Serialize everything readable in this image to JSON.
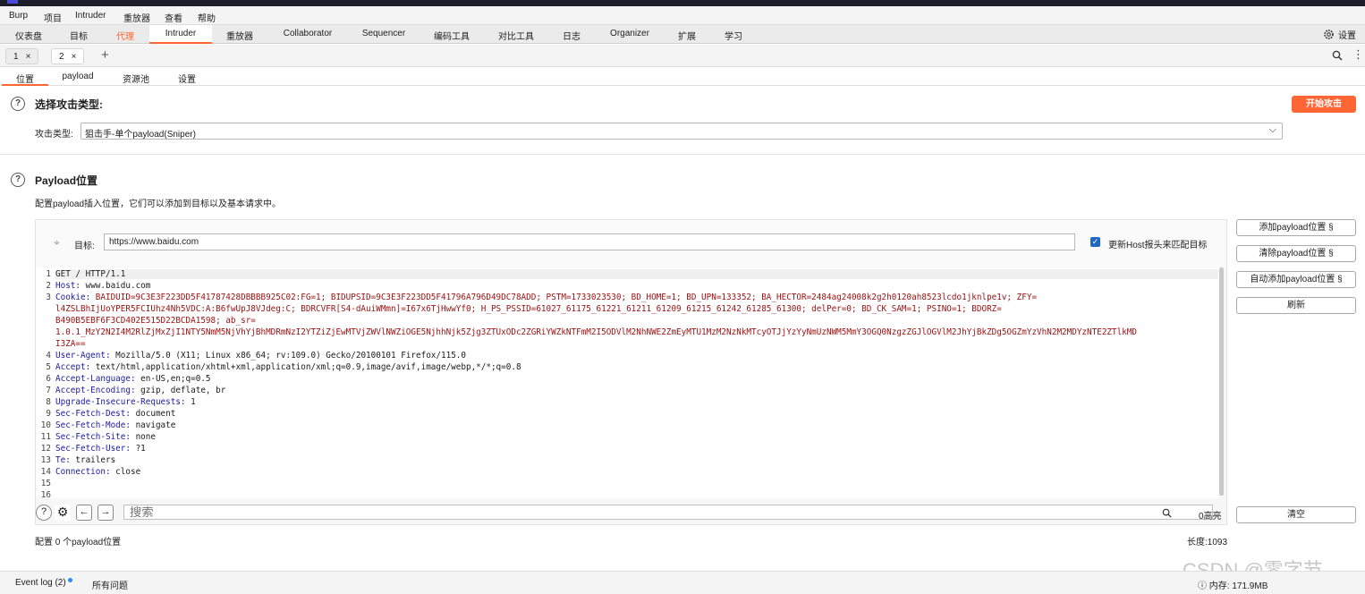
{
  "menu": [
    "Burp",
    "项目",
    "Intruder",
    "重放器",
    "查看",
    "帮助"
  ],
  "main_tabs": [
    "仪表盘",
    "目标",
    "代理",
    "Intruder",
    "重放器",
    "Collaborator",
    "Sequencer",
    "编码工具",
    "对比工具",
    "日志",
    "Organizer",
    "扩展",
    "学习"
  ],
  "settings_label": "设置",
  "request_tabs": [
    {
      "label": "1"
    },
    {
      "label": "2"
    }
  ],
  "add_tab_icon": "plus-icon",
  "sub_tabs": [
    "位置",
    "payload",
    "资源池",
    "设置"
  ],
  "section1": {
    "title": "选择攻击类型:",
    "start_button": "开始攻击",
    "attack_type_label": "攻击类型:",
    "attack_type_value": "狙击手-单个payload(Sniper)"
  },
  "section2": {
    "title": "Payload位置",
    "description": "配置payload插入位置，它们可以添加到目标以及基本请求中。"
  },
  "target": {
    "label": "目标:",
    "value": "https://www.baidu.com",
    "host_checkbox_label": "更新Host报头来匹配目标",
    "host_checked": true
  },
  "side_buttons": [
    "添加payload位置 §",
    "清除payload位置 §",
    "自动添加payload位置 §",
    "刷新"
  ],
  "clear_button": "清空",
  "request_lines": [
    {
      "no": "1",
      "text": "GET / HTTP/1.1"
    },
    {
      "no": "2",
      "text": "Host: www.baidu.com"
    },
    {
      "no": "3",
      "text": "Cookie: BAIDUID=9C3E3F223DD5F41787428DBBBB925C02:FG=1; BIDUPSID=9C3E3F223DD5F41796A796D49DC78ADD; PSTM=1733023530; BD_HOME=1; BD_UPN=133352; BA_HECTOR=2484ag24008k2g2h0120ah8523lcdo1jknlpe1v; ZFY="
    },
    {
      "no": "",
      "text": "l4ZSLBhIjUoYPER5FCIUhz4Nh5VDC:A:B6fwUpJ8VJdeg:C; BDRCVFR[S4-dAuiWMmn]=I67x6TjHwwYf0; H_PS_PSSID=61027_61175_61221_61211_61209_61215_61242_61285_61300; delPer=0; BD_CK_SAM=1; PSINO=1; BDORZ="
    },
    {
      "no": "",
      "text": "B490B5EBF6F3CD402E515D22BCDA1598; ab_sr="
    },
    {
      "no": "",
      "text": "1.0.1_MzY2N2I4M2RlZjMxZjI1NTY5NmM5NjVhYjBhMDRmNzI2YTZiZjEwMTVjZWVlNWZiOGE5NjhhNjk5Zjg3ZTUxODc2ZGRiYWZkNTFmM2I5ODVlM2NhNWE2ZmEyMTU1MzM2NzNkMTcyOTJjYzYyNmUzNWM5MmY3OGQ0NzgzZGJlOGVlM2JhYjBkZDg5OGZmYzVhN2M2MDYzNTE2ZTlkMD"
    },
    {
      "no": "",
      "text": "I3ZA=="
    },
    {
      "no": "4",
      "text": "User-Agent: Mozilla/5.0 (X11; Linux x86_64; rv:109.0) Gecko/20100101 Firefox/115.0"
    },
    {
      "no": "5",
      "text": "Accept: text/html,application/xhtml+xml,application/xml;q=0.9,image/avif,image/webp,*/*;q=0.8"
    },
    {
      "no": "6",
      "text": "Accept-Language: en-US,en;q=0.5"
    },
    {
      "no": "7",
      "text": "Accept-Encoding: gzip, deflate, br"
    },
    {
      "no": "8",
      "text": "Upgrade-Insecure-Requests: 1"
    },
    {
      "no": "9",
      "text": "Sec-Fetch-Dest: document"
    },
    {
      "no": "10",
      "text": "Sec-Fetch-Mode: navigate"
    },
    {
      "no": "11",
      "text": "Sec-Fetch-Site: none"
    },
    {
      "no": "12",
      "text": "Sec-Fetch-User: ?1"
    },
    {
      "no": "13",
      "text": "Te: trailers"
    },
    {
      "no": "14",
      "text": "Connection: close"
    },
    {
      "no": "15",
      "text": ""
    },
    {
      "no": "16",
      "text": ""
    }
  ],
  "search": {
    "placeholder": "搜索",
    "highlight_count": "0高亮"
  },
  "footer": {
    "positions": "配置 0 个payload位置",
    "length": "长度:1093"
  },
  "status": {
    "event_log": "Event log (2)",
    "all_issues": "所有问题",
    "memory": "内存: 171.9MB"
  },
  "watermark": "CSDN @零字节",
  "colors": {
    "accent": "#ff6633",
    "key": "#1a1a9c",
    "value": "#9a1010",
    "checkbox": "#2166c1"
  }
}
